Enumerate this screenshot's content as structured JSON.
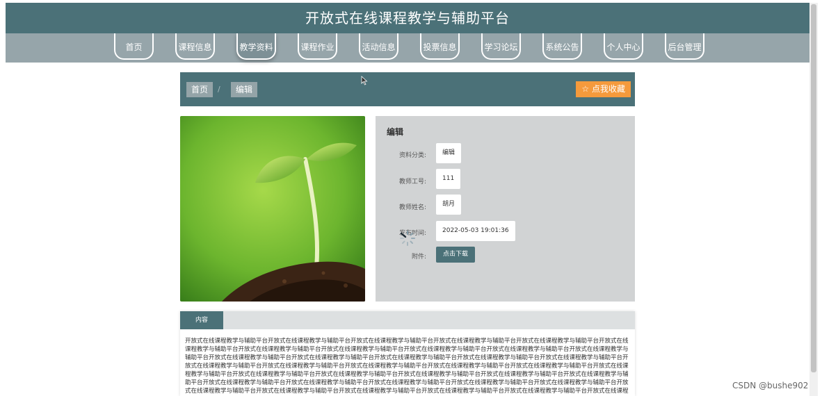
{
  "header": {
    "title": "开放式在线课程教学与辅助平台"
  },
  "nav": {
    "items": [
      {
        "label": "首页"
      },
      {
        "label": "课程信息"
      },
      {
        "label": "教学资料",
        "active": true
      },
      {
        "label": "课程作业"
      },
      {
        "label": "活动信息"
      },
      {
        "label": "投票信息"
      },
      {
        "label": "学习论坛"
      },
      {
        "label": "系统公告"
      },
      {
        "label": "个人中心"
      },
      {
        "label": "后台管理"
      }
    ]
  },
  "breadcrumb": {
    "home": "首页",
    "separator": "/",
    "current": "编辑"
  },
  "actions": {
    "favorite_label": "☆ 点我收藏"
  },
  "hero": {
    "alt": ""
  },
  "detail": {
    "title": "编辑",
    "fields": [
      {
        "label": "资料分类:",
        "value": "编辑"
      },
      {
        "label": "教师工号:",
        "value": "111"
      },
      {
        "label": "教师姓名:",
        "value": "胡月"
      },
      {
        "label": "发布时间:",
        "value": "2022-05-03 19:01:36"
      }
    ],
    "attachment_label": "附件:",
    "download_label": "点击下载"
  },
  "content": {
    "tab_label": "内容",
    "text": "开放式在线课程教学与辅助平台开放式在线课程教学与辅助平台开放式在线课程教学与辅助平台开放式在线课程教学与辅助平台开放式在线课程教学与辅助平台开放式在线课程教学与辅助平台开放式在线课程教学与辅助平台开放式在线课程教学与辅助平台开放式在线课程教学与辅助平台开放式在线课程教学与辅助平台开放式在线课程教学与辅助平台开放式在线课程教学与辅助平台开放式在线课程教学与辅助平台开放式在线课程教学与辅助平台开放式在线课程教学与辅助平台开放式在线课程教学与辅助平台开放式在线课程教学与辅助平台开放式在线课程教学与辅助平台开放式在线课程教学与辅助平台开放式在线课程教学与辅助平台开放式在线课程教学与辅助平台开放式在线课程教学与辅助平台开放式在线课程教学与辅助平台开放式在线课程教学与辅助平台开放式在线课程教学与辅助平台开放式在线课程教学与辅助平台开放式在线课程教学与辅助平台开放式在线课程教学与辅助平台开放式在线课程教学与辅助平台开放式在线课程教学与辅助平台开放式在线课程教学与辅助平台开放式在线课程教学与辅助平台开放式在线课程教学与辅助平台开放式在线课程教学与辅助平台开放式在线课程教学与辅助平台开放式在线课程教学与辅助平台开放式在线课程教学与辅助平台开放式在线课程教学与辅助平台开放式在线课程教学与辅助平台开放式在线课程教学与辅助平台开放式在线课程教学与辅助平台开放式在线课程教学与辅助平台开放式在线课程教学与辅助平台开放式在线课程教学与辅助平台开放式在线课程教学与辅助平台开放式在线课程教学与辅助平台开放式在线课程教学与辅助平台开放式在线课程教学与辅助平台开放式在线课程教学与辅助平台开放式在线课程教学与辅助平台开放式在线课程教学与辅助平台开放式在线课程教学与辅助平台"
  },
  "watermark": "CSDN @bushe902",
  "colors": {
    "header_bg": "#4b7178",
    "nav_bg": "#96a5aa",
    "accent_orange": "#f59a3c",
    "panel_bg": "#d1d3d4"
  },
  "icons": {
    "favorite": "star-outline-icon",
    "cursor": "mouse-pointer-icon",
    "loading": "loading-spinner-icon"
  }
}
